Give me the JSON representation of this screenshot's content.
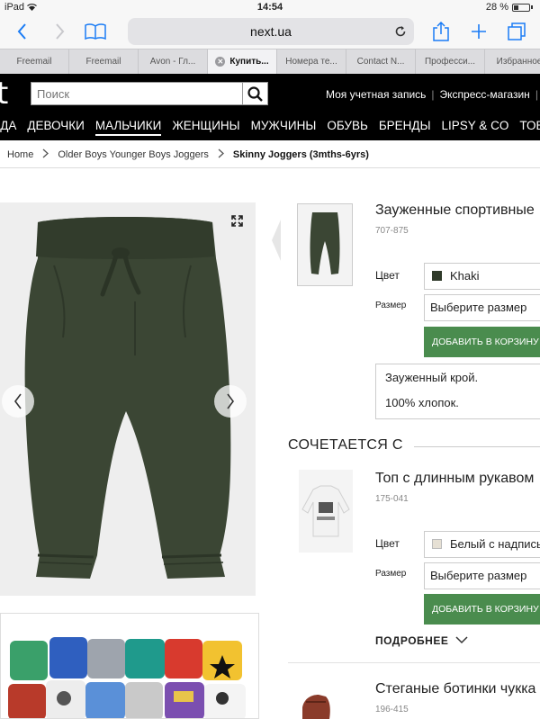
{
  "status_bar": {
    "device": "iPad",
    "time": "14:54",
    "battery": "28 %"
  },
  "browser": {
    "url": "next.ua",
    "tabs": [
      {
        "label": "Freemail",
        "active": false
      },
      {
        "label": "Freemail",
        "active": false
      },
      {
        "label": "Avon - Гл...",
        "active": false
      },
      {
        "label": "Купить...",
        "active": true
      },
      {
        "label": "Номера те...",
        "active": false
      },
      {
        "label": "Contact N...",
        "active": false
      },
      {
        "label": "Професси...",
        "active": false
      },
      {
        "label": "Избранное",
        "active": false
      }
    ]
  },
  "header": {
    "logo": "t",
    "search_placeholder": "Поиск",
    "account": "Моя учетная запись",
    "express": "Экспресс-магазин"
  },
  "nav": [
    "ОДА",
    "ДЕВОЧКИ",
    "МАЛЬЧИКИ",
    "ЖЕНЩИНЫ",
    "МУЖЧИНЫ",
    "ОБУВЬ",
    "БРЕНДЫ",
    "LIPSY & CO",
    "ТОВА"
  ],
  "breadcrumb": {
    "home": "Home",
    "category": "Older Boys Younger Boys Joggers",
    "current": "Skinny Joggers (3mths-6yrs)"
  },
  "product": {
    "title": "Зауженные спортивные",
    "code": "707-875",
    "color_label": "Цвет",
    "color_value": "Khaki",
    "color_hex": "#2f3a2a",
    "size_label": "Размер",
    "size_value": "Выберите размер",
    "add_to_cart": "ДОБАВИТЬ В КОРЗИНУ",
    "description": [
      "Зауженный крой.",
      "100% хлопок."
    ]
  },
  "matches_heading": "СОЧЕТАЕТСЯ С",
  "related": [
    {
      "title": "Топ с длинным рукавом",
      "code": "175-041",
      "color_label": "Цвет",
      "color_value": "Белый с надпись",
      "color_hex": "#e6e0d4",
      "size_label": "Размер",
      "size_value": "Выберите размер",
      "add_to_cart": "ДОБАВИТЬ В КОРЗИНУ",
      "more": "ПОДРОБНЕЕ"
    },
    {
      "title": "Стеганые ботинки чукка",
      "code": "196-415"
    }
  ],
  "colors": {
    "nav_bg": "#000000",
    "button_green": "#4a8c4e",
    "link_blue": "#1a7cf5",
    "pants": "#3b4634"
  }
}
